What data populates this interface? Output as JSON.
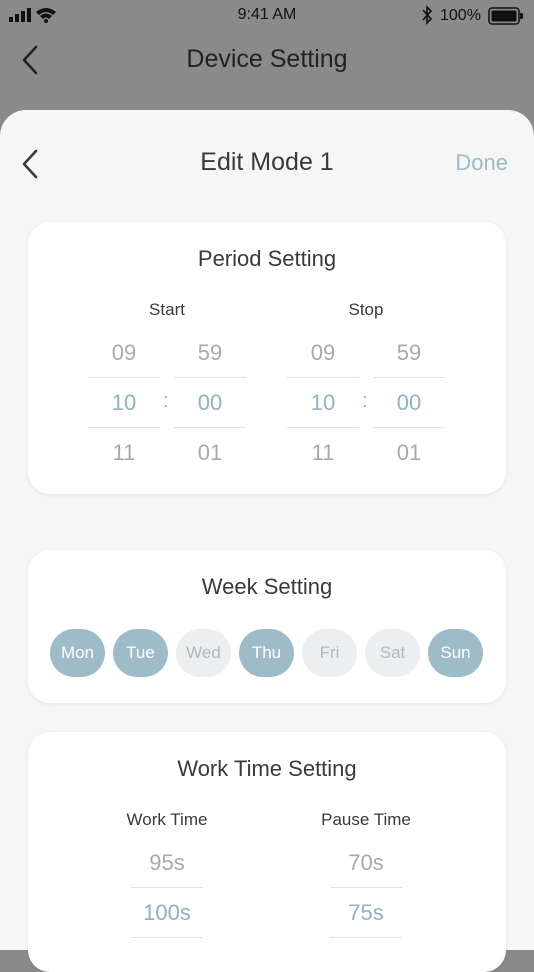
{
  "status_bar": {
    "time": "9:41 AM",
    "battery": "100%"
  },
  "nav": {
    "title": "Device Setting"
  },
  "sheet": {
    "title": "Edit Mode 1",
    "done_label": "Done"
  },
  "period": {
    "title": "Period Setting",
    "start_label": "Start",
    "stop_label": "Stop",
    "start_hours": [
      "09",
      "10",
      "11"
    ],
    "start_minutes": [
      "59",
      "00",
      "01"
    ],
    "stop_hours": [
      "09",
      "10",
      "11"
    ],
    "stop_minutes": [
      "59",
      "00",
      "01"
    ],
    "separator": ":"
  },
  "week": {
    "title": "Week Setting",
    "days": [
      {
        "label": "Mon",
        "selected": true
      },
      {
        "label": "Tue",
        "selected": true
      },
      {
        "label": "Wed",
        "selected": false
      },
      {
        "label": "Thu",
        "selected": true
      },
      {
        "label": "Fri",
        "selected": false
      },
      {
        "label": "Sat",
        "selected": false
      },
      {
        "label": "Sun",
        "selected": true
      }
    ]
  },
  "work_time": {
    "title": "Work Time Setting",
    "work_label": "Work Time",
    "pause_label": "Pause Time",
    "work_values": [
      "95s",
      "100s"
    ],
    "pause_values": [
      "70s",
      "75s"
    ]
  },
  "colors": {
    "accent": "#8fb3c1",
    "day_on": "#9dbcc7",
    "day_off": "#eceef0"
  }
}
